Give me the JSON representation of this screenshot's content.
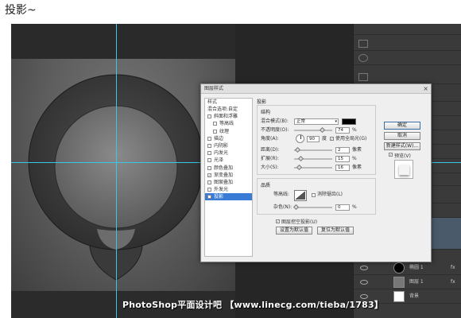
{
  "caption": "投影~",
  "dialog": {
    "title": "图层样式",
    "close": "×",
    "style_list": {
      "header": "样式",
      "items": [
        {
          "label": "混合选项:自定",
          "checkbox": false,
          "checked": false,
          "indent": false,
          "selected": false
        },
        {
          "label": "斜面和浮雕",
          "checkbox": true,
          "checked": false,
          "indent": false,
          "selected": false
        },
        {
          "label": "等高线",
          "checkbox": true,
          "checked": false,
          "indent": true,
          "selected": false
        },
        {
          "label": "纹理",
          "checkbox": true,
          "checked": false,
          "indent": true,
          "selected": false
        },
        {
          "label": "描边",
          "checkbox": true,
          "checked": false,
          "indent": false,
          "selected": false
        },
        {
          "label": "内阴影",
          "checkbox": true,
          "checked": false,
          "indent": false,
          "selected": false
        },
        {
          "label": "内发光",
          "checkbox": true,
          "checked": false,
          "indent": false,
          "selected": false
        },
        {
          "label": "光泽",
          "checkbox": true,
          "checked": false,
          "indent": false,
          "selected": false
        },
        {
          "label": "颜色叠加",
          "checkbox": true,
          "checked": false,
          "indent": false,
          "selected": false
        },
        {
          "label": "渐变叠加",
          "checkbox": true,
          "checked": true,
          "indent": false,
          "selected": false
        },
        {
          "label": "图案叠加",
          "checkbox": true,
          "checked": false,
          "indent": false,
          "selected": false
        },
        {
          "label": "外发光",
          "checkbox": true,
          "checked": false,
          "indent": false,
          "selected": false
        },
        {
          "label": "投影",
          "checkbox": true,
          "checked": true,
          "indent": false,
          "selected": true
        }
      ]
    },
    "section_title": "投影",
    "structure": {
      "label": "结构",
      "blend_mode_label": "混合模式(B):",
      "blend_mode_value": "正常",
      "opacity_label": "不透明度(O):",
      "opacity_value": "74",
      "opacity_fraction": 0.74,
      "percent": "%",
      "angle_label": "角度(A):",
      "angle_value": "90",
      "angle_unit": "度",
      "global_light_label": "使用全局光(G)",
      "distance_label": "距离(D):",
      "distance_value": "2",
      "spread_label": "扩展(R):",
      "spread_value": "15",
      "size_label": "大小(S):",
      "size_value": "16",
      "px_unit": "像素"
    },
    "quality": {
      "label": "品质",
      "contour_label": "等高线:",
      "anti_alias_label": "消除锯齿(L)",
      "noise_label": "杂色(N):",
      "noise_value": "0",
      "knockout_label": "图层挖空投影(U)"
    },
    "buttons": {
      "make_default": "设置为默认值",
      "reset_default": "复位为默认值",
      "ok": "确定",
      "cancel": "取消",
      "new_style": "新建样式(W)...",
      "preview_label": "预览(V)"
    }
  },
  "layers": {
    "rows": [
      {
        "name": "椭圆 1",
        "fx": "fx"
      },
      {
        "name": "图层 1",
        "fx": "fx"
      },
      {
        "name": "背景",
        "fx": ""
      }
    ]
  },
  "watermark": "PhotoShop平面设计吧 【www.linecg.com/tieba/1783】",
  "colors": {
    "guide": "#3ac6e8",
    "shadow_swatch": "#000000",
    "selection": "#3a7bd5"
  }
}
